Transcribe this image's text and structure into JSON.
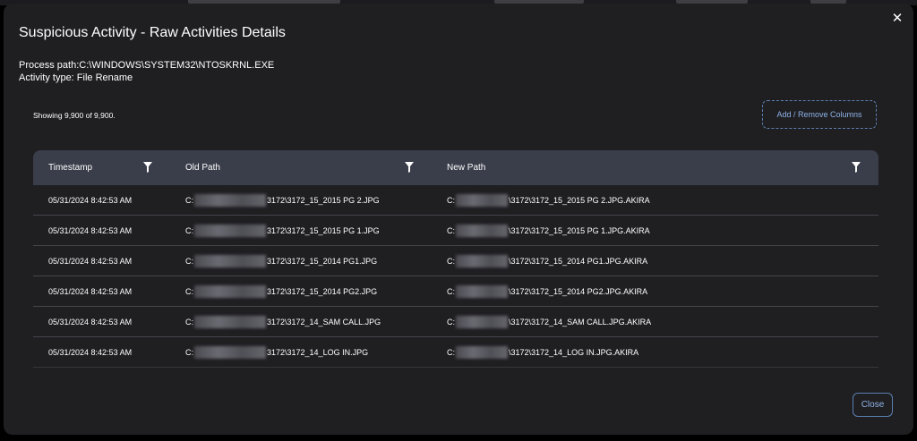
{
  "modal": {
    "title": "Suspicious Activity - Raw Activities Details",
    "process_path": "Process path:C:\\WINDOWS\\SYSTEM32\\NTOSKRNL.EXE",
    "activity_type": "Activity type: File Rename",
    "showing": "Showing 9,900 of 9,900.",
    "columns_button": "Add / Remove Columns",
    "close_button": "Close",
    "close_icon": "close-icon",
    "accent_color": "#8fb3e6"
  },
  "table": {
    "headers": [
      "Timestamp",
      "Old Path",
      "New Path"
    ],
    "filter_icon": "filter-icon",
    "rows": [
      {
        "timestamp": "05/31/2024 8:42:53 AM",
        "old_prefix": "C:",
        "old_suffix": "3172\\3172_15_2015 PG 2.JPG",
        "new_prefix": "C:",
        "new_suffix": "\\3172\\3172_15_2015 PG 2.JPG.AKIRA"
      },
      {
        "timestamp": "05/31/2024 8:42:53 AM",
        "old_prefix": "C:",
        "old_suffix": "3172\\3172_15_2015 PG 1.JPG",
        "new_prefix": "C:",
        "new_suffix": "\\3172\\3172_15_2015 PG 1.JPG.AKIRA"
      },
      {
        "timestamp": "05/31/2024 8:42:53 AM",
        "old_prefix": "C:",
        "old_suffix": "3172\\3172_15_2014 PG1.JPG",
        "new_prefix": "C:",
        "new_suffix": "\\3172\\3172_15_2014 PG1.JPG.AKIRA"
      },
      {
        "timestamp": "05/31/2024 8:42:53 AM",
        "old_prefix": "C:",
        "old_suffix": "3172\\3172_15_2014 PG2.JPG",
        "new_prefix": "C:",
        "new_suffix": "\\3172\\3172_15_2014 PG2.JPG.AKIRA"
      },
      {
        "timestamp": "05/31/2024 8:42:53 AM",
        "old_prefix": "C:",
        "old_suffix": "3172\\3172_14_SAM CALL.JPG",
        "new_prefix": "C:",
        "new_suffix": "\\3172\\3172_14_SAM CALL.JPG.AKIRA"
      },
      {
        "timestamp": "05/31/2024 8:42:53 AM",
        "old_prefix": "C:",
        "old_suffix": "3172\\3172_14_LOG IN.JPG",
        "new_prefix": "C:",
        "new_suffix": "\\3172\\3172_14_LOG IN.JPG.AKIRA"
      }
    ]
  }
}
